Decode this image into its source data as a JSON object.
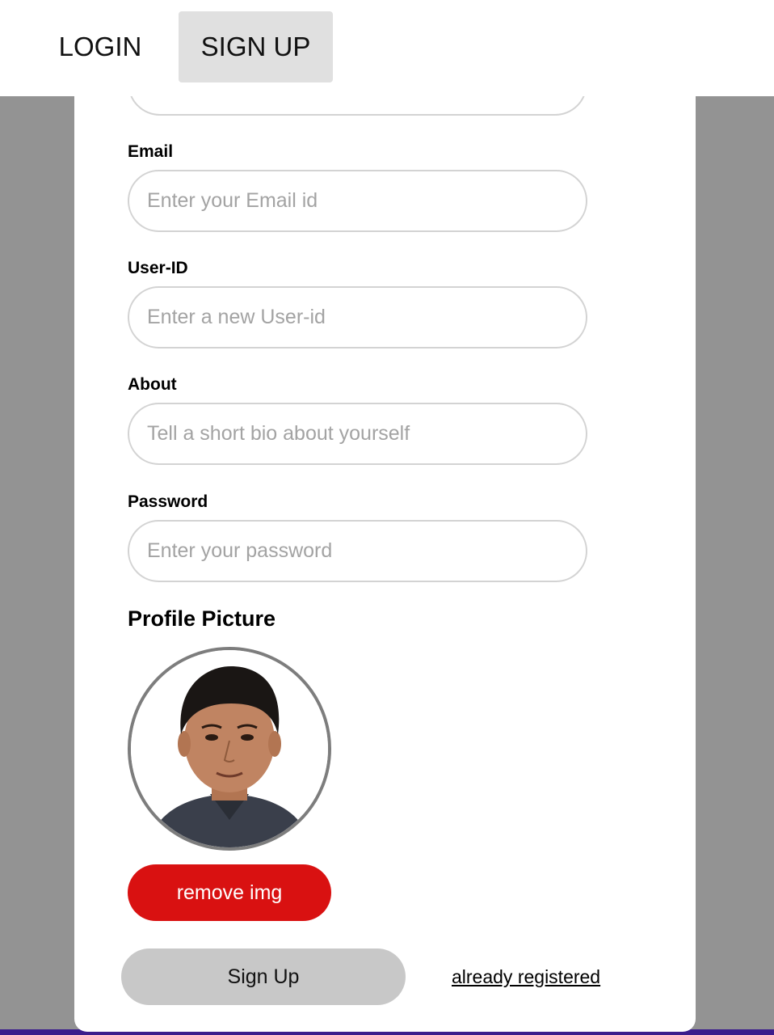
{
  "nav": {
    "login_label": "LOGIN",
    "signup_label": "SIGN UP"
  },
  "form": {
    "email_label": "Email",
    "email_placeholder": "Enter your Email id",
    "userid_label": "User-ID",
    "userid_placeholder": "Enter a new User-id",
    "about_label": "About",
    "about_placeholder": "Tell a short bio about yourself",
    "password_label": "Password",
    "password_placeholder": "Enter your password",
    "profile_picture_title": "Profile Picture",
    "remove_image_label": "remove img",
    "signup_button_label": "Sign Up",
    "already_registered_link": "already registered"
  },
  "colors": {
    "active_tab_bg": "#e0e0e0",
    "remove_button": "#d91111",
    "signup_button": "#c8c8c8",
    "page_background": "#939393"
  }
}
